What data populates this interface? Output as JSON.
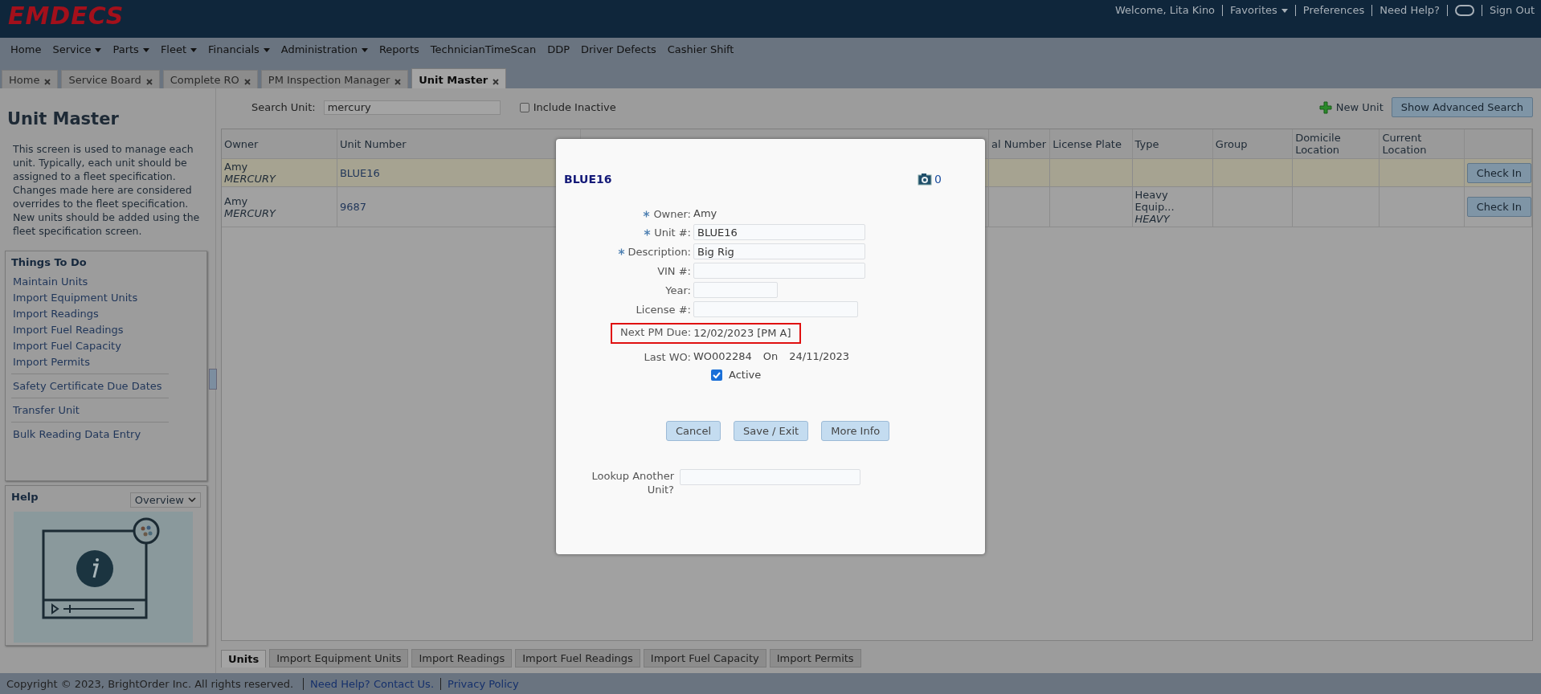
{
  "header": {
    "logo": "EMDECS",
    "user_links": [
      {
        "label": "Welcome, Lita Kino",
        "kind": "text"
      },
      {
        "label": "Favorites",
        "kind": "menu"
      },
      {
        "label": "Preferences",
        "kind": "link"
      },
      {
        "label": "Need Help?",
        "kind": "link"
      },
      {
        "kind": "toggle"
      },
      {
        "label": "Sign Out",
        "kind": "link"
      }
    ]
  },
  "menu": [
    {
      "label": "Home",
      "dropdown": false
    },
    {
      "label": "Service",
      "dropdown": true
    },
    {
      "label": "Parts",
      "dropdown": true
    },
    {
      "label": "Fleet",
      "dropdown": true
    },
    {
      "label": "Financials",
      "dropdown": true
    },
    {
      "label": "Administration",
      "dropdown": true
    },
    {
      "label": "Reports",
      "dropdown": false
    },
    {
      "label": "TechnicianTimeScan",
      "dropdown": false
    },
    {
      "label": "DDP",
      "dropdown": false
    },
    {
      "label": "Driver Defects",
      "dropdown": false
    },
    {
      "label": "Cashier Shift",
      "dropdown": false
    }
  ],
  "tabs": [
    {
      "label": "Home",
      "selected": false
    },
    {
      "label": "Service Board",
      "selected": false
    },
    {
      "label": "Complete RO",
      "selected": false
    },
    {
      "label": "PM Inspection Manager",
      "selected": false
    },
    {
      "label": "Unit Master",
      "selected": true
    }
  ],
  "sidebar": {
    "title": "Unit Master",
    "description": "This screen is used to manage each unit. Typically, each unit should be assigned to a fleet specification. Changes made here are considered overrides to the fleet specification. New units should be added using the fleet specification screen.",
    "things_to_do": {
      "title": "Things To Do",
      "sections": [
        [
          "Maintain Units",
          "Import Equipment Units",
          "Import Readings",
          "Import Fuel Readings",
          "Import Fuel Capacity",
          "Import Permits"
        ],
        [
          "Safety Certificate Due Dates"
        ],
        [
          "Transfer Unit"
        ],
        [
          "Bulk Reading Data Entry"
        ]
      ]
    },
    "help": {
      "title": "Help",
      "dropdown": "Overview"
    }
  },
  "search": {
    "label": "Search Unit:",
    "value": "mercury",
    "include_inactive": {
      "label": "Include Inactive",
      "checked": false
    },
    "new_unit": "New Unit",
    "advanced": "Show Advanced Search"
  },
  "table": {
    "columns": [
      "Owner",
      "Unit Number",
      "",
      "al Number",
      "License Plate",
      "Type",
      "Group",
      "Domicile Location",
      "Current Location",
      ""
    ],
    "rows": [
      {
        "selected": true,
        "owner": "Amy",
        "owner_sub": "MERCURY",
        "unit": "BLUE16",
        "type": "",
        "type_sub": "",
        "action": "Check In"
      },
      {
        "selected": false,
        "owner": "Amy",
        "owner_sub": "MERCURY",
        "unit": "9687",
        "type": "Heavy Equip...",
        "type_sub": "HEAVY",
        "action": "Check In"
      }
    ]
  },
  "bottom_tabs": [
    {
      "label": "Units",
      "selected": true
    },
    {
      "label": "Import Equipment Units",
      "selected": false
    },
    {
      "label": "Import Readings",
      "selected": false
    },
    {
      "label": "Import Fuel Readings",
      "selected": false
    },
    {
      "label": "Import Fuel Capacity",
      "selected": false
    },
    {
      "label": "Import Permits",
      "selected": false
    }
  ],
  "footer": {
    "copyright": "Copyright © 2023, BrightOrder Inc. All rights reserved.",
    "links": [
      "Need Help? Contact Us.",
      "Privacy Policy"
    ]
  },
  "dialog": {
    "title": "BLUE16",
    "attachments": "0",
    "fields": [
      {
        "label": "Owner:",
        "required": true,
        "kind": "static",
        "value": "Amy",
        "highlighted": false
      },
      {
        "label": "Unit #:",
        "required": true,
        "kind": "input",
        "value": "BLUE16",
        "highlighted": false
      },
      {
        "label": "Description:",
        "required": true,
        "kind": "input",
        "value": "Big Rig",
        "highlighted": false
      },
      {
        "label": "VIN #:",
        "required": false,
        "kind": "input",
        "highlighted": false
      },
      {
        "label": "Year:",
        "required": false,
        "kind": "shortinput",
        "highlighted": false
      },
      {
        "label": "License #:",
        "required": false,
        "kind": "midinput",
        "highlighted": false
      },
      {
        "label": "Next PM Due:",
        "required": false,
        "kind": "static",
        "value": "12/02/2023  [PM A]",
        "highlighted": true
      },
      {
        "label": "Last WO:",
        "required": false,
        "kind": "workorder",
        "value": "WO002284",
        "on_label": "On",
        "date": "24/11/2023",
        "highlighted": false
      }
    ],
    "active": {
      "label": "Active",
      "checked": true
    },
    "buttons": [
      "Cancel",
      "Save / Exit",
      "More Info"
    ],
    "lookup": {
      "label": "Lookup Another Unit?"
    }
  }
}
